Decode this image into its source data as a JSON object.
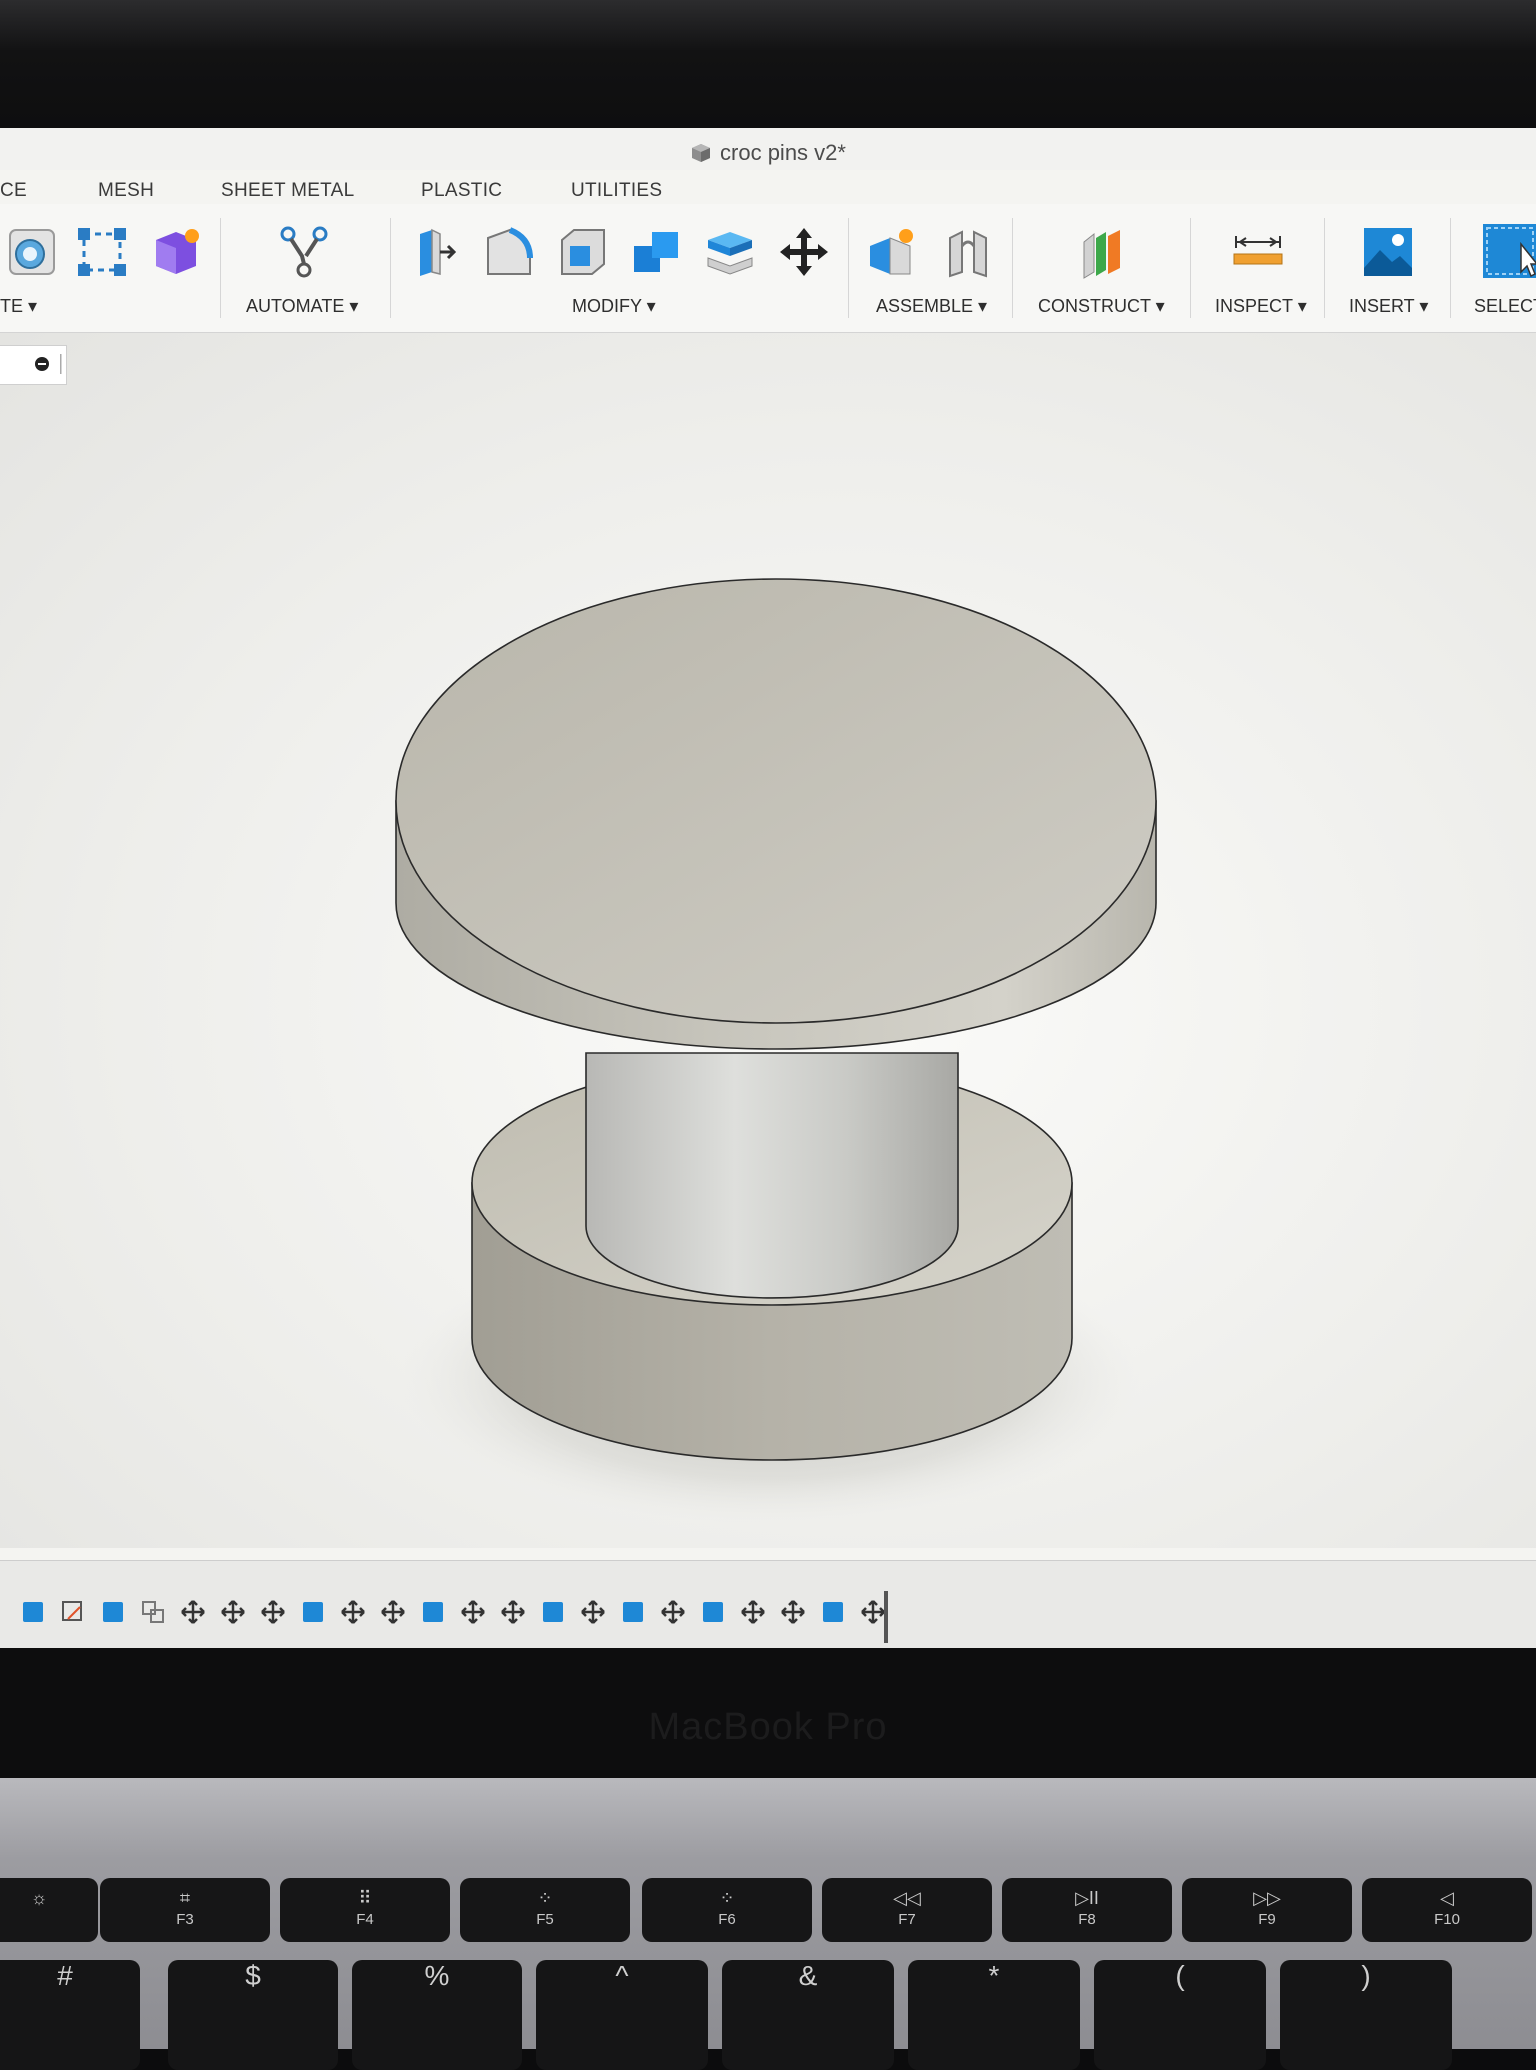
{
  "document": {
    "title": "croc pins v2*"
  },
  "tabs": [
    "CE",
    "MESH",
    "SHEET METAL",
    "PLASTIC",
    "UTILITIES"
  ],
  "toolbar_groups": {
    "create": "TE",
    "automate": "AUTOMATE",
    "modify": "MODIFY",
    "assemble": "ASSEMBLE",
    "construct": "CONSTRUCT",
    "inspect": "INSPECT",
    "insert": "INSERT",
    "select": "SELECT"
  },
  "laptop": {
    "brand": "MacBook Pro"
  },
  "keys": {
    "fn": [
      {
        "sym": "☼",
        "label": ""
      },
      {
        "sym": "⌗",
        "label": "F3"
      },
      {
        "sym": "⠿",
        "label": "F4"
      },
      {
        "sym": "⁘",
        "label": "F5"
      },
      {
        "sym": "⁘",
        "label": "F6"
      },
      {
        "sym": "◁◁",
        "label": "F7"
      },
      {
        "sym": "▷II",
        "label": "F8"
      },
      {
        "sym": "▷▷",
        "label": "F9"
      },
      {
        "sym": "◁",
        "label": "F10"
      }
    ],
    "num": [
      "#",
      "$",
      "%",
      "^",
      "&",
      "*",
      "(",
      ")"
    ]
  },
  "colors": {
    "accent_blue": "#1e88d6",
    "ribbon_bg": "#f7f7f5",
    "viewport_bg": "#f4f4f1",
    "model_face": "#c9c7bd"
  }
}
